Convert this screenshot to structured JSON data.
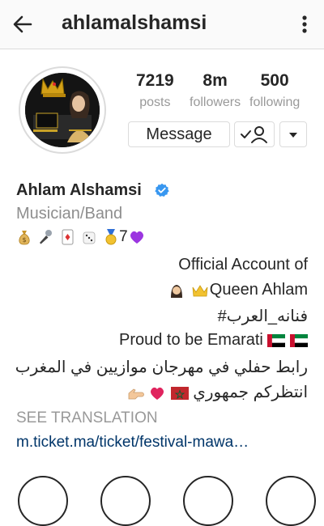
{
  "header": {
    "username": "ahlamalshamsi"
  },
  "stats": [
    {
      "value": "7219",
      "label": "posts"
    },
    {
      "value": "8m",
      "label": "followers"
    },
    {
      "value": "500",
      "label": "following"
    }
  ],
  "actions": {
    "message_label": "Message"
  },
  "profile": {
    "name": "Ahlam Alshamsi",
    "category": "Musician/Band",
    "emoji_suffix": "7",
    "bio_lines": [
      "Official Account of",
      "Queen Ahlam",
      "#فنانه_العرب",
      "Proud to be Emarati",
      "رابط حفلي في مهرجان موازيين في المغرب",
      "انتظركم جمهوري"
    ],
    "see_translation": "SEE TRANSLATION",
    "link": "m.ticket.ma/ticket/festival-mawa…"
  },
  "colors": {
    "link": "#003569",
    "verified": "#3897f0",
    "muted": "#8e8e8e"
  }
}
